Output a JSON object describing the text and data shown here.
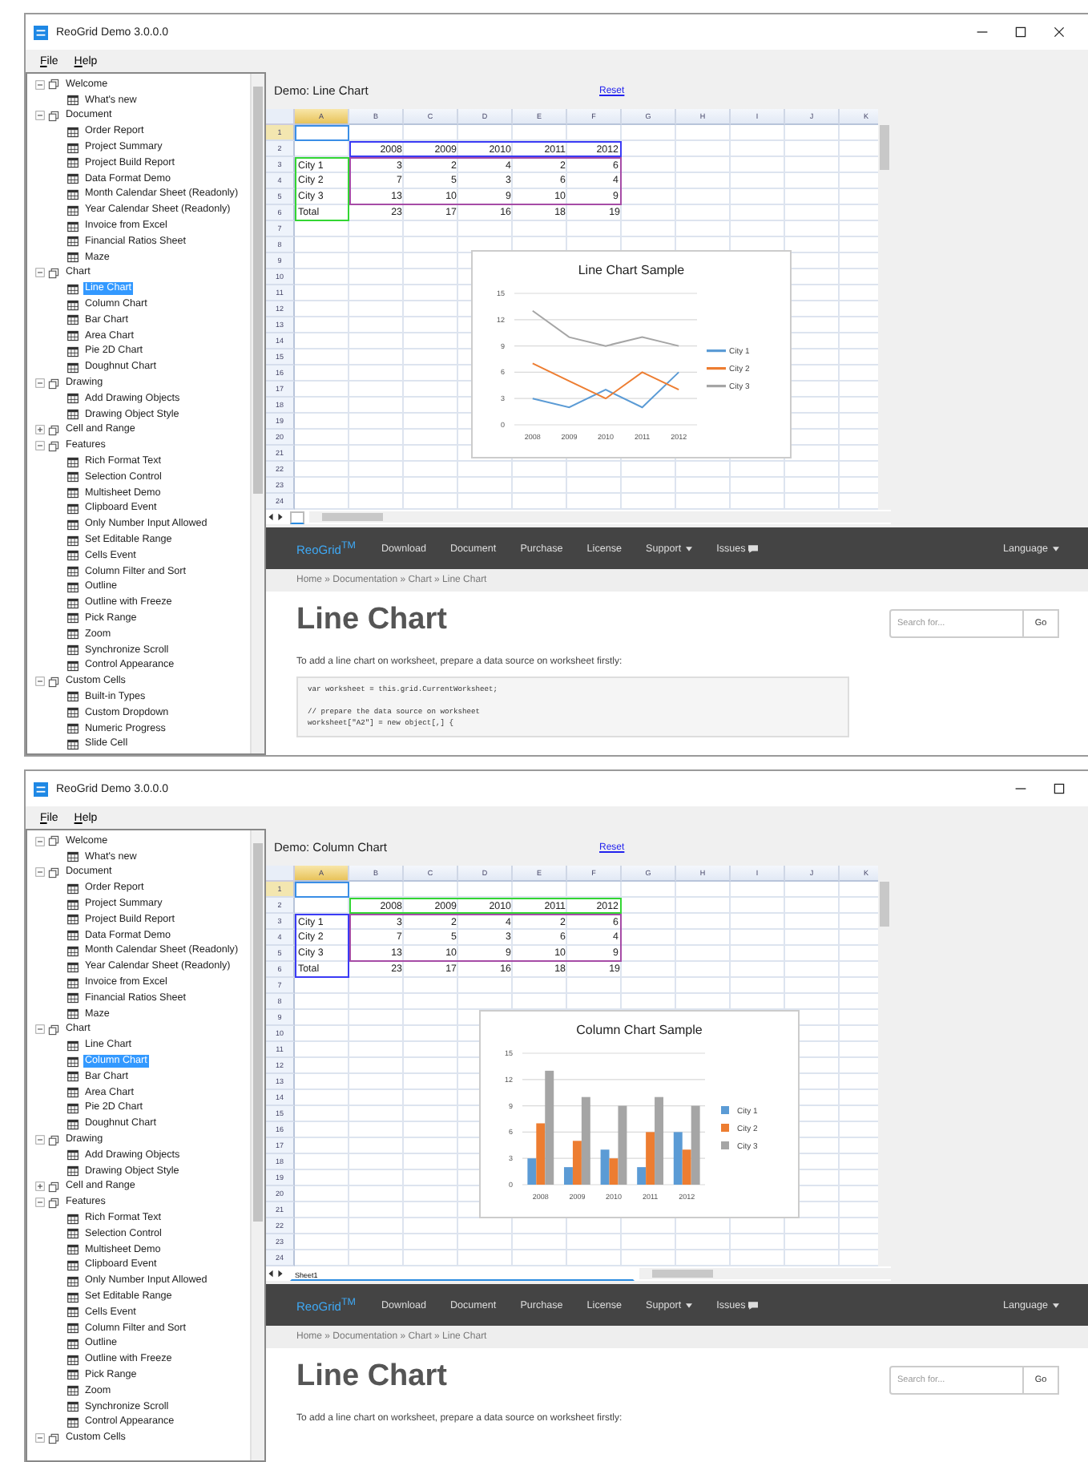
{
  "windows": [
    {
      "title": "ReoGrid Demo 3.0.0.0",
      "window_buttons": [
        {
          "kind": "minimize"
        },
        {
          "kind": "maximize"
        },
        {
          "kind": "close"
        }
      ],
      "menu": [
        "File",
        "Help"
      ],
      "tree": [
        {
          "label": "Welcome",
          "expanded": true,
          "children": [
            {
              "label": "What's new",
              "selected": false
            }
          ]
        },
        {
          "label": "Document",
          "expanded": true,
          "children": [
            {
              "label": "Order Report",
              "selected": false
            },
            {
              "label": "Project Summary",
              "selected": false
            },
            {
              "label": "Project Build Report",
              "selected": false
            },
            {
              "label": "Data Format Demo",
              "selected": false
            },
            {
              "label": "Month Calendar Sheet (Readonly)",
              "selected": false
            },
            {
              "label": "Year Calendar Sheet (Readonly)",
              "selected": false
            },
            {
              "label": "Invoice from Excel",
              "selected": false
            },
            {
              "label": "Financial Ratios Sheet",
              "selected": false
            },
            {
              "label": "Maze",
              "selected": false
            }
          ]
        },
        {
          "label": "Chart",
          "expanded": true,
          "children": [
            {
              "label": "Line Chart",
              "selected": true
            },
            {
              "label": "Column Chart",
              "selected": false
            },
            {
              "label": "Bar Chart",
              "selected": false
            },
            {
              "label": "Area Chart",
              "selected": false
            },
            {
              "label": "Pie 2D Chart",
              "selected": false
            },
            {
              "label": "Doughnut Chart",
              "selected": false
            }
          ]
        },
        {
          "label": "Drawing",
          "expanded": true,
          "children": [
            {
              "label": "Add Drawing Objects",
              "selected": false
            },
            {
              "label": "Drawing Object Style",
              "selected": false
            }
          ]
        },
        {
          "label": "Cell and Range",
          "expanded": false
        },
        {
          "label": "Features",
          "expanded": true,
          "children": [
            {
              "label": "Rich Format Text",
              "selected": false
            },
            {
              "label": "Selection Control",
              "selected": false
            },
            {
              "label": "Multisheet Demo",
              "selected": false
            },
            {
              "label": "Clipboard Event",
              "selected": false
            },
            {
              "label": "Only Number Input Allowed",
              "selected": false
            },
            {
              "label": "Set Editable Range",
              "selected": false
            },
            {
              "label": "Cells Event",
              "selected": false
            },
            {
              "label": "Column Filter and Sort",
              "selected": false
            },
            {
              "label": "Outline",
              "selected": false
            },
            {
              "label": "Outline with Freeze",
              "selected": false
            },
            {
              "label": "Pick Range",
              "selected": false
            },
            {
              "label": "Zoom",
              "selected": false
            },
            {
              "label": "Synchronize Scroll",
              "selected": false
            },
            {
              "label": "Control Appearance",
              "selected": false
            }
          ]
        },
        {
          "label": "Custom Cells",
          "expanded": true,
          "children": [
            {
              "label": "Built-in Types",
              "selected": false
            },
            {
              "label": "Custom Dropdown",
              "selected": false
            },
            {
              "label": "Numeric Progress",
              "selected": false
            },
            {
              "label": "Slide Cell",
              "selected": false
            }
          ]
        }
      ],
      "demo": {
        "title": "Demo: Line Chart",
        "reset": "Reset"
      },
      "sheet": {
        "columns": [
          {
            "label": "A",
            "selected": true
          },
          {
            "label": "B",
            "selected": false
          },
          {
            "label": "C",
            "selected": false
          },
          {
            "label": "D",
            "selected": false
          },
          {
            "label": "E",
            "selected": false
          },
          {
            "label": "F",
            "selected": false
          },
          {
            "label": "G",
            "selected": false
          },
          {
            "label": "H",
            "selected": false
          },
          {
            "label": "I",
            "selected": false
          },
          {
            "label": "J",
            "selected": false
          },
          {
            "label": "K",
            "selected": false
          }
        ],
        "row_headers": [
          {
            "label": "1",
            "selected": true
          },
          {
            "label": "2",
            "selected": false,
            "cells": [
              null,
              {
                "text": "2008",
                "color": "#3b3bf5"
              },
              {
                "text": "2009",
                "color": "#3b3bf5"
              },
              {
                "text": "2010",
                "color": "#3b3bf5"
              },
              {
                "text": "2011",
                "color": "#3b3bf5"
              },
              {
                "text": "2012",
                "color": "#3b3bf5"
              }
            ]
          },
          {
            "label": "3",
            "selected": false,
            "cells": [
              {
                "text": "City 1",
                "color": "#33d633"
              },
              {
                "text": "3",
                "color": "#a64ca6"
              },
              {
                "text": "2",
                "color": "#a64ca6"
              },
              {
                "text": "4",
                "color": "#a64ca6"
              },
              {
                "text": "2",
                "color": "#a64ca6"
              },
              {
                "text": "6",
                "color": "#a64ca6"
              }
            ]
          },
          {
            "label": "4",
            "selected": false,
            "cells": [
              {
                "text": "City 2",
                "color": "#33d633"
              },
              {
                "text": "7",
                "color": "#a64ca6"
              },
              {
                "text": "5"
              },
              {
                "text": "3"
              },
              {
                "text": "6"
              },
              {
                "text": "4",
                "color": "#a64ca6"
              }
            ]
          },
          {
            "label": "5",
            "selected": false,
            "cells": [
              {
                "text": "City 3",
                "color": "#33d633"
              },
              {
                "text": "13",
                "color": "#a64ca6"
              },
              {
                "text": "10",
                "color": "#a64ca6"
              },
              {
                "text": "9",
                "color": "#a64ca6"
              },
              {
                "text": "10",
                "color": "#a64ca6"
              },
              {
                "text": "9",
                "color": "#a64ca6"
              }
            ]
          },
          {
            "label": "6",
            "selected": false,
            "cells": [
              {
                "text": "Total",
                "color": "#33d633"
              },
              {
                "text": "23"
              },
              {
                "text": "17"
              },
              {
                "text": "16"
              },
              {
                "text": "18"
              },
              {
                "text": "19"
              }
            ]
          },
          {
            "label": "7",
            "selected": false
          },
          {
            "label": "8",
            "selected": false
          },
          {
            "label": "9",
            "selected": false
          },
          {
            "label": "10",
            "selected": false
          },
          {
            "label": "11",
            "selected": false
          },
          {
            "label": "12",
            "selected": false
          },
          {
            "label": "13",
            "selected": false
          },
          {
            "label": "14",
            "selected": false
          },
          {
            "label": "15",
            "selected": false
          },
          {
            "label": "16",
            "selected": false
          },
          {
            "label": "17",
            "selected": false
          },
          {
            "label": "18",
            "selected": false
          },
          {
            "label": "19",
            "selected": false
          },
          {
            "label": "20",
            "selected": false
          },
          {
            "label": "21",
            "selected": false
          },
          {
            "label": "22",
            "selected": false
          },
          {
            "label": "23",
            "selected": false
          },
          {
            "label": "24",
            "selected": false
          }
        ],
        "chart": {
          "chart_data": {
            "type": "line",
            "title": "Line Chart Sample",
            "categories": [
              "2008",
              "2009",
              "2010",
              "2011",
              "2012"
            ],
            "series": [
              {
                "name": "City 1",
                "color": "#5b9bd5",
                "values": [
                  3,
                  2,
                  4,
                  2,
                  6
                ]
              },
              {
                "name": "City 2",
                "color": "#ed7d31",
                "values": [
                  7,
                  5,
                  3,
                  6,
                  4
                ]
              },
              {
                "name": "City 3",
                "color": "#a5a5a5",
                "values": [
                  13,
                  10,
                  9,
                  10,
                  9
                ]
              }
            ],
            "ylim": [
              0,
              15
            ],
            "yticks": [
              0,
              3,
              6,
              9,
              12,
              15
            ],
            "grid": true,
            "legend": "right"
          }
        },
        "sheet_tabs": [
          {
            "selected": true
          }
        ]
      },
      "web": {
        "brand": "ReoGrid$^{TM}$",
        "nav": [
          {
            "label": "Download",
            "kind": "link"
          },
          {
            "label": "Document",
            "kind": "link"
          },
          {
            "label": "Purchase",
            "kind": "link"
          },
          {
            "label": "License",
            "kind": "link"
          },
          {
            "label": "Support",
            "kind": "dropdown"
          },
          {
            "label": "Issues",
            "kind": "chat"
          }
        ],
        "language": "Language",
        "breadcrumb": "Home » Documentation » Chart » Line Chart",
        "heading": "Line Chart",
        "search_placeholder": "Search for...",
        "search_button": "Go",
        "intro": "To add a line chart on worksheet, prepare a data source on worksheet firstly:",
        "code": "var worksheet = this.grid.CurrentWorksheet;\n\n// prepare the data source on worksheet\nworksheet[\"A2\"] = new object[,] {"
      }
    },
    {
      "title": "ReoGrid Demo 3.0.0.0",
      "window_buttons": [
        {
          "kind": "minimize"
        },
        {
          "kind": "maximize"
        }
      ],
      "menu": [
        "File",
        "Help"
      ],
      "tree": [
        {
          "label": "Welcome",
          "expanded": true,
          "children": [
            {
              "label": "What's new",
              "selected": false
            }
          ]
        },
        {
          "label": "Document",
          "expanded": true,
          "children": [
            {
              "label": "Order Report",
              "selected": false
            },
            {
              "label": "Project Summary",
              "selected": false
            },
            {
              "label": "Project Build Report",
              "selected": false
            },
            {
              "label": "Data Format Demo",
              "selected": false
            },
            {
              "label": "Month Calendar Sheet (Readonly)",
              "selected": false
            },
            {
              "label": "Year Calendar Sheet (Readonly)",
              "selected": false
            },
            {
              "label": "Invoice from Excel",
              "selected": false
            },
            {
              "label": "Financial Ratios Sheet",
              "selected": false
            },
            {
              "label": "Maze",
              "selected": false
            }
          ]
        },
        {
          "label": "Chart",
          "expanded": true,
          "children": [
            {
              "label": "Line Chart",
              "selected": false
            },
            {
              "label": "Column Chart",
              "selected": true
            },
            {
              "label": "Bar Chart",
              "selected": false
            },
            {
              "label": "Area Chart",
              "selected": false
            },
            {
              "label": "Pie 2D Chart",
              "selected": false
            },
            {
              "label": "Doughnut Chart",
              "selected": false
            }
          ]
        },
        {
          "label": "Drawing",
          "expanded": true,
          "children": [
            {
              "label": "Add Drawing Objects",
              "selected": false
            },
            {
              "label": "Drawing Object Style",
              "selected": false
            }
          ]
        },
        {
          "label": "Cell and Range",
          "expanded": false
        },
        {
          "label": "Features",
          "expanded": true,
          "children": [
            {
              "label": "Rich Format Text",
              "selected": false
            },
            {
              "label": "Selection Control",
              "selected": false
            },
            {
              "label": "Multisheet Demo",
              "selected": false
            },
            {
              "label": "Clipboard Event",
              "selected": false
            },
            {
              "label": "Only Number Input Allowed",
              "selected": false
            },
            {
              "label": "Set Editable Range",
              "selected": false
            },
            {
              "label": "Cells Event",
              "selected": false
            },
            {
              "label": "Column Filter and Sort",
              "selected": false
            },
            {
              "label": "Outline",
              "selected": false
            },
            {
              "label": "Outline with Freeze",
              "selected": false
            },
            {
              "label": "Pick Range",
              "selected": false
            },
            {
              "label": "Zoom",
              "selected": false
            },
            {
              "label": "Synchronize Scroll",
              "selected": false
            },
            {
              "label": "Control Appearance",
              "selected": false
            }
          ]
        },
        {
          "label": "Custom Cells",
          "expanded": true
        }
      ],
      "demo": {
        "title": "Demo: Column Chart",
        "reset": "Reset"
      },
      "sheet": {
        "columns": [
          {
            "label": "A",
            "selected": true
          },
          {
            "label": "B",
            "selected": false
          },
          {
            "label": "C",
            "selected": false
          },
          {
            "label": "D",
            "selected": false
          },
          {
            "label": "E",
            "selected": false
          },
          {
            "label": "F",
            "selected": false
          },
          {
            "label": "G",
            "selected": false
          },
          {
            "label": "H",
            "selected": false
          },
          {
            "label": "I",
            "selected": false
          },
          {
            "label": "J",
            "selected": false
          },
          {
            "label": "K",
            "selected": false
          }
        ],
        "row_headers": [
          {
            "label": "1",
            "selected": true
          },
          {
            "label": "2",
            "selected": false,
            "cells": [
              null,
              {
                "text": "2008",
                "color": "#33d633"
              },
              {
                "text": "2009",
                "color": "#33d633"
              },
              {
                "text": "2010",
                "color": "#33d633"
              },
              {
                "text": "2011",
                "color": "#33d633"
              },
              {
                "text": "2012",
                "color": "#33d633"
              }
            ]
          },
          {
            "label": "3",
            "selected": false,
            "cells": [
              {
                "text": "City 1",
                "color": "#3b3bf5"
              },
              {
                "text": "3",
                "color": "#a64ca6"
              },
              {
                "text": "2",
                "color": "#a64ca6"
              },
              {
                "text": "4",
                "color": "#a64ca6"
              },
              {
                "text": "2",
                "color": "#a64ca6"
              },
              {
                "text": "6",
                "color": "#a64ca6"
              }
            ]
          },
          {
            "label": "4",
            "selected": false,
            "cells": [
              {
                "text": "City 2",
                "color": "#3b3bf5"
              },
              {
                "text": "7",
                "color": "#a64ca6"
              },
              {
                "text": "5"
              },
              {
                "text": "3"
              },
              {
                "text": "6"
              },
              {
                "text": "4",
                "color": "#a64ca6"
              }
            ]
          },
          {
            "label": "5",
            "selected": false,
            "cells": [
              {
                "text": "City 3",
                "color": "#3b3bf5"
              },
              {
                "text": "13",
                "color": "#a64ca6"
              },
              {
                "text": "10",
                "color": "#a64ca6"
              },
              {
                "text": "9",
                "color": "#a64ca6"
              },
              {
                "text": "10",
                "color": "#a64ca6"
              },
              {
                "text": "9",
                "color": "#a64ca6"
              }
            ]
          },
          {
            "label": "6",
            "selected": false,
            "cells": [
              {
                "text": "Total",
                "color": "#3b3bf5"
              },
              {
                "text": "23"
              },
              {
                "text": "17"
              },
              {
                "text": "16"
              },
              {
                "text": "18"
              },
              {
                "text": "19"
              }
            ]
          },
          {
            "label": "7",
            "selected": false
          },
          {
            "label": "8",
            "selected": false
          },
          {
            "label": "9",
            "selected": false
          },
          {
            "label": "10",
            "selected": false
          },
          {
            "label": "11",
            "selected": false
          },
          {
            "label": "12",
            "selected": false
          },
          {
            "label": "13",
            "selected": false
          },
          {
            "label": "14",
            "selected": false
          },
          {
            "label": "15",
            "selected": false
          },
          {
            "label": "16",
            "selected": false
          },
          {
            "label": "17",
            "selected": false
          },
          {
            "label": "18",
            "selected": false
          },
          {
            "label": "19",
            "selected": false
          },
          {
            "label": "20",
            "selected": false
          },
          {
            "label": "21",
            "selected": false
          },
          {
            "label": "22",
            "selected": false
          },
          {
            "label": "23",
            "selected": false
          },
          {
            "label": "24",
            "selected": false
          }
        ],
        "chart": {
          "chart_data": {
            "type": "bar",
            "title": "Column Chart Sample",
            "categories": [
              "2008",
              "2009",
              "2010",
              "2011",
              "2012"
            ],
            "series": [
              {
                "name": "City 1",
                "color": "#5b9bd5",
                "values": [
                  3,
                  2,
                  4,
                  2,
                  6
                ]
              },
              {
                "name": "City 2",
                "color": "#ed7d31",
                "values": [
                  7,
                  5,
                  3,
                  6,
                  4
                ]
              },
              {
                "name": "City 3",
                "color": "#a5a5a5",
                "values": [
                  13,
                  10,
                  9,
                  10,
                  9
                ]
              }
            ],
            "ylim": [
              0,
              15
            ],
            "yticks": [
              0,
              3,
              6,
              9,
              12,
              15
            ],
            "grid": true,
            "legend": "right"
          }
        },
        "sheet_tabs": [
          {
            "label": "Sheet1",
            "selected": true
          }
        ]
      },
      "web": {
        "brand": "ReoGrid$^{TM}$",
        "nav": [
          {
            "label": "Download",
            "kind": "link"
          },
          {
            "label": "Document",
            "kind": "link"
          },
          {
            "label": "Purchase",
            "kind": "link"
          },
          {
            "label": "License",
            "kind": "link"
          },
          {
            "label": "Support",
            "kind": "dropdown"
          },
          {
            "label": "Issues",
            "kind": "chat"
          }
        ],
        "language": "Language",
        "breadcrumb": "Home » Documentation » Chart » Line Chart",
        "heading": "Line Chart",
        "search_placeholder": "Search for...",
        "search_button": "Go",
        "intro": "To add a line chart on worksheet, prepare a data source on worksheet firstly:"
      }
    }
  ]
}
